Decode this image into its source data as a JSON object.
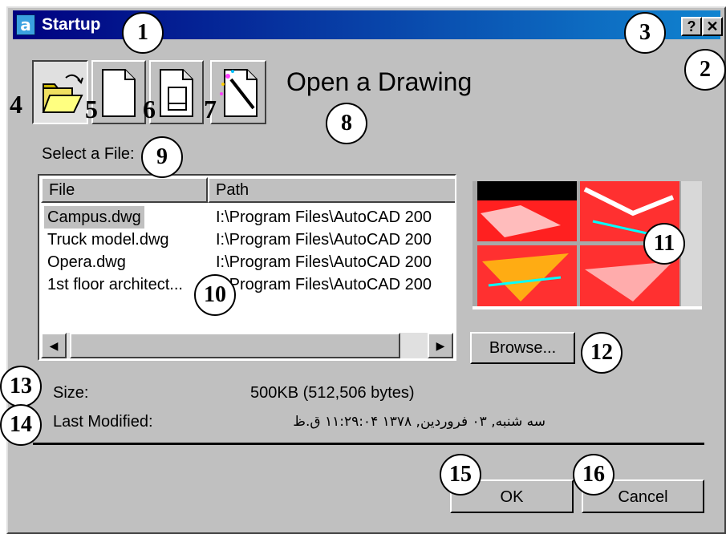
{
  "window": {
    "title": "Startup",
    "help_glyph": "?",
    "close_glyph": "✕"
  },
  "callouts": [
    "1",
    "2",
    "3",
    "4",
    "5",
    "6",
    "7",
    "8",
    "9",
    "10",
    "11",
    "12",
    "13",
    "14",
    "15",
    "16"
  ],
  "modes": {
    "selected": "open",
    "heading": "Open a Drawing",
    "icons": [
      "open-folder-icon",
      "blank-document-icon",
      "template-document-icon",
      "wizard-document-icon"
    ]
  },
  "file_panel": {
    "label": "Select a File:",
    "columns": [
      "File",
      "Path"
    ],
    "rows": [
      {
        "file": "Campus.dwg",
        "path": "I:\\Program Files\\AutoCAD 200"
      },
      {
        "file": "Truck model.dwg",
        "path": "I:\\Program Files\\AutoCAD 200"
      },
      {
        "file": "Opera.dwg",
        "path": "I:\\Program Files\\AutoCAD 200"
      },
      {
        "file": "1st floor architect...",
        "path": "I:\\Program Files\\AutoCAD 200"
      }
    ],
    "scroll_left": "◀",
    "scroll_right": "▶"
  },
  "browse_label": "Browse...",
  "details": {
    "size_label": "Size:",
    "size_value": "500KB (512,506 bytes)",
    "modified_label": "Last Modified:",
    "modified_value": "سه شنبه, ۰۳ فروردین, ۱۳۷۸ ۱۱:۲۹:۰۴ ق.ظ"
  },
  "buttons": {
    "ok": "OK",
    "cancel": "Cancel"
  },
  "colors": {
    "title_bar_start": "#000080",
    "title_bar_end": "#1084d0",
    "dialog_face": "#c0c0c0"
  }
}
